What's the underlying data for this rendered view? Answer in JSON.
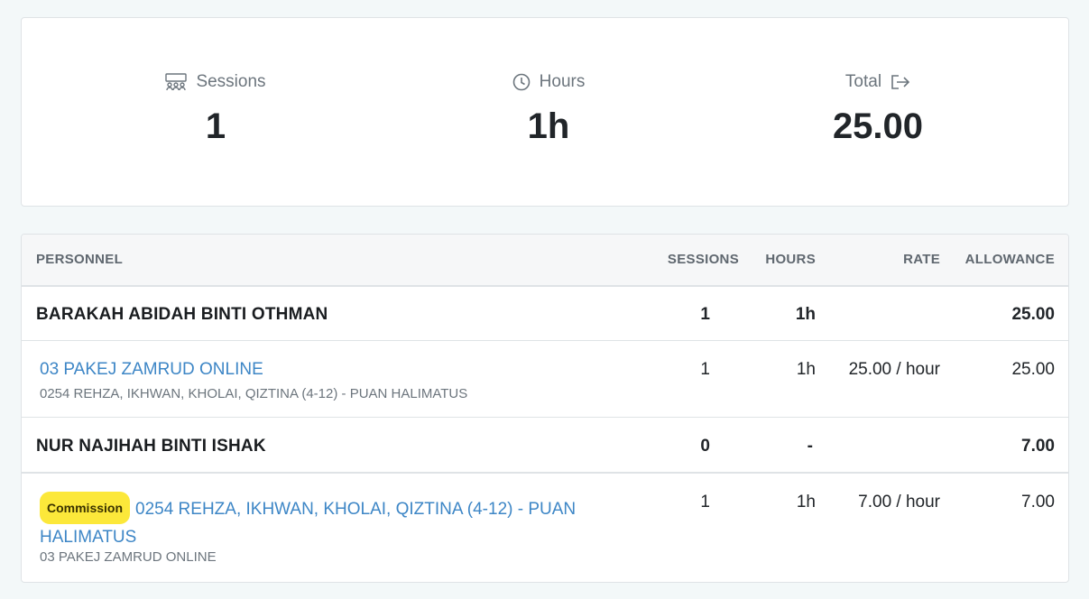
{
  "summary": {
    "sessions": {
      "label": "Sessions",
      "value": "1",
      "icon": "group-icon"
    },
    "hours": {
      "label": "Hours",
      "value": "1h",
      "icon": "clock-icon"
    },
    "total": {
      "label": "Total",
      "value": "25.00",
      "icon": "export-icon"
    }
  },
  "table": {
    "headers": {
      "personnel": "PERSONNEL",
      "sessions": "SESSIONS",
      "hours": "HOURS",
      "rate": "RATE",
      "allowance": "ALLOWANCE"
    },
    "groups": [
      {
        "name": "BARAKAH ABIDAH BINTI OTHMAN",
        "sessions": "1",
        "hours": "1h",
        "allowance": "25.00",
        "items": [
          {
            "badge": "",
            "title": "03 PAKEJ ZAMRUD ONLINE",
            "subtitle": "0254 REHZA, IKHWAN, KHOLAI, QIZTINA (4-12) - PUAN HALIMATUS",
            "sessions": "1",
            "hours": "1h",
            "rate": "25.00 / hour",
            "allowance": "25.00"
          }
        ]
      },
      {
        "name": "NUR NAJIHAH BINTI ISHAK",
        "sessions": "0",
        "hours": "-",
        "allowance": "7.00",
        "items": [
          {
            "badge": "Commission",
            "title_line1": "0254 REHZA, IKHWAN, KHOLAI, QIZTINA (4-12) - PUAN",
            "title_line2": "HALIMATUS",
            "subtitle": "03 PAKEJ ZAMRUD ONLINE",
            "sessions": "1",
            "hours": "1h",
            "rate": "7.00 / hour",
            "allowance": "7.00"
          }
        ]
      }
    ]
  },
  "colors": {
    "link": "#3d86c6",
    "badge": "#fce83a",
    "background": "#f3f8f9"
  }
}
